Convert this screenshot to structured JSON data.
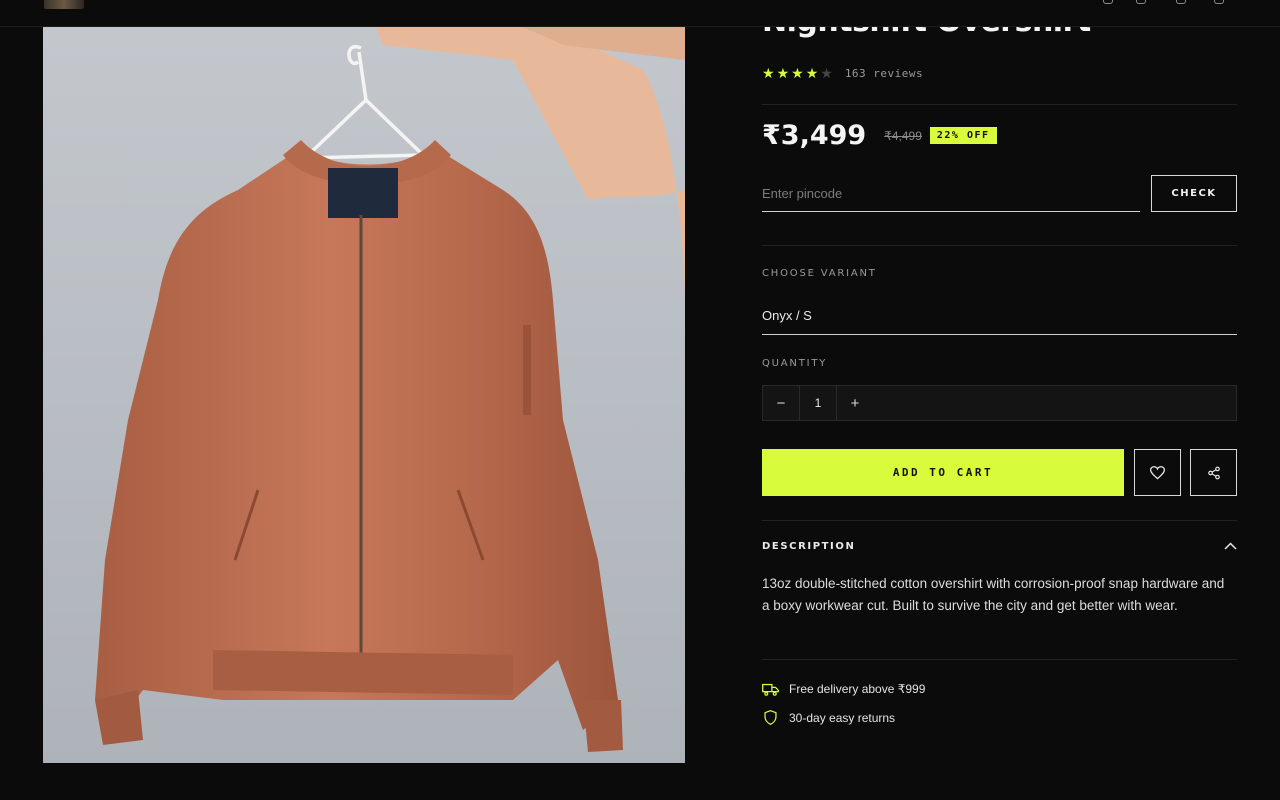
{
  "product": {
    "title": "Nightshift Overshirt",
    "rating_stars": 4,
    "rating_max": 5,
    "reviews_label": "163 reviews",
    "price": "₹3,499",
    "compare_price": "₹4,499",
    "discount_badge": "22% OFF"
  },
  "pincode": {
    "placeholder": "Enter pincode",
    "value": "",
    "button_label": "CHECK"
  },
  "variant": {
    "label": "CHOOSE VARIANT",
    "selected": "Onyx / S"
  },
  "quantity": {
    "label": "QUANTITY",
    "decrement": "−",
    "value": "1",
    "increment": "+"
  },
  "actions": {
    "add_to_cart": "ADD TO CART",
    "wishlist_icon": "heart-icon",
    "share_icon": "share-icon"
  },
  "description": {
    "heading": "DESCRIPTION",
    "body": "13oz double-stitched cotton overshirt with corrosion-proof snap hardware and a boxy workwear cut. Built to survive the city and get better with wear."
  },
  "perks": [
    {
      "icon": "truck-icon",
      "text": "Free delivery above ₹999"
    },
    {
      "icon": "shield-icon",
      "text": "30-day easy returns"
    }
  ],
  "colors": {
    "background": "#0b0b0b",
    "accent": "#d8fb3c",
    "text": "#eaeaea",
    "muted": "#9a9a9a"
  }
}
